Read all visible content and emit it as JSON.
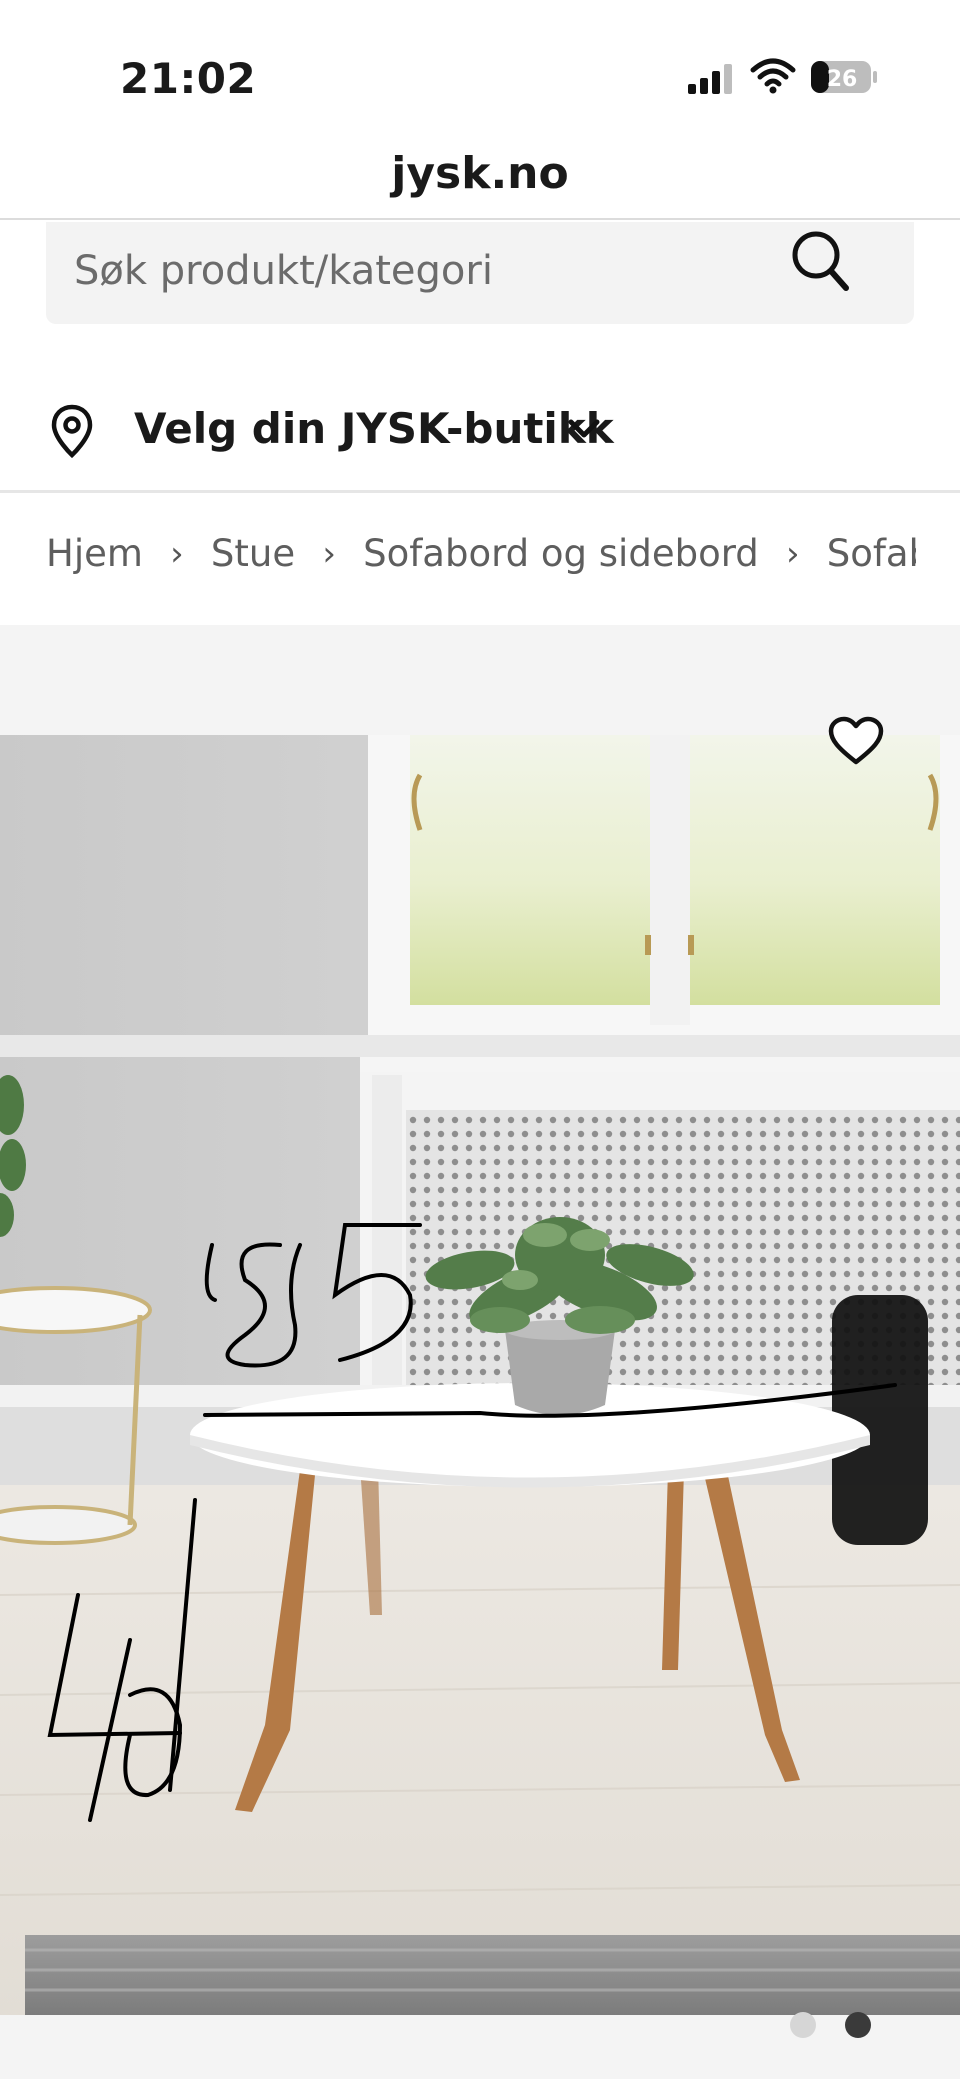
{
  "status_bar": {
    "time": "21:02",
    "battery_level": "26",
    "icons": [
      "signal-icon",
      "wifi-icon",
      "battery-icon"
    ]
  },
  "browser": {
    "url": "jysk.no"
  },
  "search": {
    "placeholder": "Søk produkt/kategori",
    "icon": "search-icon"
  },
  "store": {
    "label": "Velg din JYSK-butikk",
    "icons": [
      "location-pin-icon",
      "chevron-down-icon"
    ]
  },
  "breadcrumb": {
    "items": [
      "Hjem",
      "Stue",
      "Sofabord og sidebord",
      "Sofabord"
    ],
    "separator": "›"
  },
  "product_image": {
    "handwritten_annotations": [
      "85",
      "40"
    ],
    "favorite_icon": "heart-icon",
    "carousel": {
      "total": 2,
      "active": 2
    }
  },
  "colors": {
    "search_bg": "#f3f3f3",
    "band_bg": "#f4f4f4",
    "dot_inactive": "#d6d6d6",
    "dot_active": "#3a3a3a"
  }
}
